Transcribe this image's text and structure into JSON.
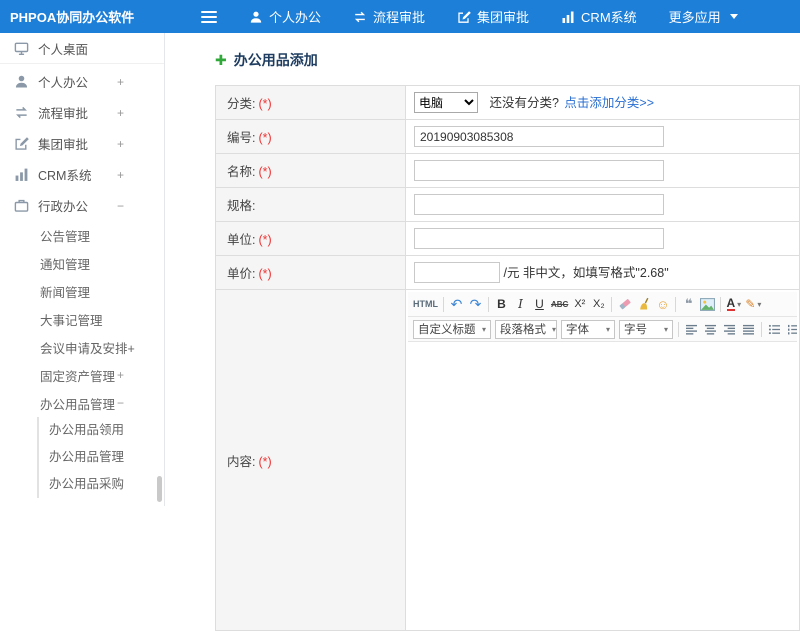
{
  "header": {
    "logo": "PHPOA协同办公软件",
    "nav": [
      {
        "label": "个人办公",
        "icon": "user-icon"
      },
      {
        "label": "流程审批",
        "icon": "flow-icon"
      },
      {
        "label": "集团审批",
        "icon": "edit-icon"
      },
      {
        "label": "CRM系统",
        "icon": "chart-icon"
      },
      {
        "label": "更多应用",
        "icon": "caret-down-icon"
      }
    ]
  },
  "sidebar": {
    "desktop_item": {
      "label": "个人桌面",
      "icon": "desktop-icon"
    },
    "items": [
      {
        "label": "个人办公",
        "icon": "user-icon",
        "expander": "+"
      },
      {
        "label": "流程审批",
        "icon": "flow-icon",
        "expander": "+"
      },
      {
        "label": "集团审批",
        "icon": "edit-icon",
        "expander": "+"
      },
      {
        "label": "CRM系统",
        "icon": "chart-icon",
        "expander": "+"
      },
      {
        "label": "行政办公",
        "icon": "briefcase-icon",
        "expander": "−"
      }
    ],
    "admin_children": [
      {
        "label": "公告管理"
      },
      {
        "label": "通知管理"
      },
      {
        "label": "新闻管理"
      },
      {
        "label": "大事记管理"
      },
      {
        "label": "会议申请及安排+"
      },
      {
        "label": "固定资产管理",
        "expander": "+"
      },
      {
        "label": "办公用品管理",
        "expander": "−"
      }
    ],
    "supplies_children": [
      {
        "label": "办公用品领用"
      },
      {
        "label": "办公用品管理"
      },
      {
        "label": "办公用品采购"
      }
    ]
  },
  "main": {
    "add_icon": "✚",
    "page_title": "办公用品添加",
    "form": {
      "category": {
        "label": "分类:",
        "required_mark": "(*)",
        "selected": "电脑",
        "hint": "还没有分类?",
        "add_link": "点击添加分类>>"
      },
      "code": {
        "label": "编号:",
        "required_mark": "(*)",
        "value": "20190903085308"
      },
      "name": {
        "label": "名称:",
        "required_mark": "(*)",
        "value": ""
      },
      "spec": {
        "label": "规格:",
        "value": ""
      },
      "unit": {
        "label": "单位:",
        "required_mark": "(*)",
        "value": ""
      },
      "price": {
        "label": "单价:",
        "required_mark": "(*)",
        "value": "",
        "suffix": "/元 非中文，如填写格式\"2.68\""
      },
      "content": {
        "label": "内容:",
        "required_mark": "(*)"
      }
    }
  },
  "editor": {
    "caret": "▾",
    "buttons": {
      "html_source": "HTML",
      "undo": "↶",
      "redo": "↷",
      "bold": "B",
      "italic": "I",
      "underline": "U",
      "strikethrough": "ABC",
      "superscript": "X²",
      "subscript": "X₂",
      "emoticon": "☺",
      "blockquote": "❝",
      "font_color": "A",
      "highlight_pen": "✎"
    },
    "icon_only_buttons": [
      "eraser-icon",
      "broom-icon",
      "image-icon"
    ],
    "align_icons": [
      "align-left-icon",
      "align-center-icon",
      "align-right-icon",
      "align-justify-icon"
    ],
    "list_icons": [
      "unordered-list-icon",
      "ordered-list-icon"
    ],
    "selects": [
      {
        "label": "自定义标题"
      },
      {
        "label": "段落格式"
      },
      {
        "label": "字体"
      },
      {
        "label": "字号"
      }
    ]
  }
}
